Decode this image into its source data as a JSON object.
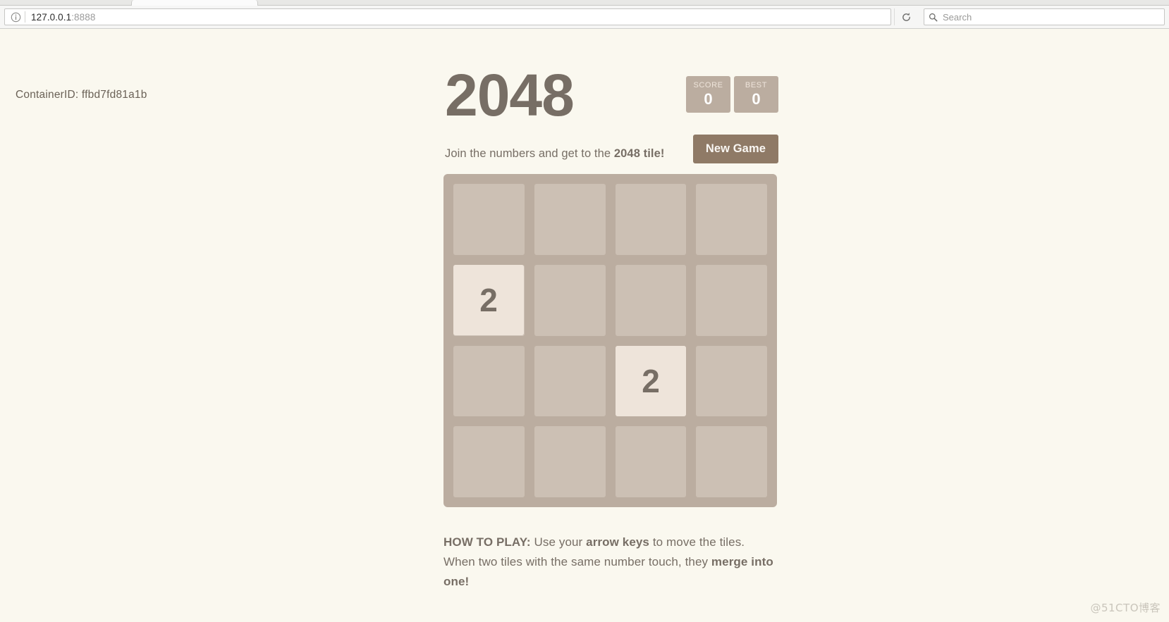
{
  "browser": {
    "identity_icon": "info-icon",
    "url_host": "127.0.0.1",
    "url_port": ":8888",
    "reload_icon": "reload-icon",
    "search_icon": "search-icon",
    "search_placeholder": "Search",
    "search_value": ""
  },
  "page": {
    "container_id_text": "ContainerID: ffbd7fd81a1b",
    "watermark": "@51CTO博客",
    "background_color": "#faf8ef"
  },
  "game": {
    "title": "2048",
    "scores": [
      {
        "label": "SCORE",
        "value": "0",
        "name": "score-box"
      },
      {
        "label": "BEST",
        "value": "0",
        "name": "best-box"
      }
    ],
    "intro_prefix": "Join the numbers and get to the ",
    "intro_strong": "2048 tile!",
    "restart_label": "New Game",
    "explanation_strong_1": "HOW TO PLAY:",
    "explanation_part_1": " Use your ",
    "explanation_strong_2": "arrow keys",
    "explanation_part_2": " to move the tiles. When two tiles with the same number touch, they ",
    "explanation_strong_3": "merge into one!",
    "grid": {
      "rows": 4,
      "cols": 4,
      "cell_count": 16
    },
    "tiles": [
      {
        "value": "2",
        "row": 1,
        "col": 0
      },
      {
        "value": "2",
        "row": 2,
        "col": 2
      }
    ],
    "colors": {
      "grid_background": "#bbada0",
      "cell": "rgba(238,228,218,0.35)",
      "tile_2_bg": "#eee4da",
      "tile_2_text": "#776e65",
      "button": "#8f7a66",
      "text": "#776e65"
    }
  }
}
